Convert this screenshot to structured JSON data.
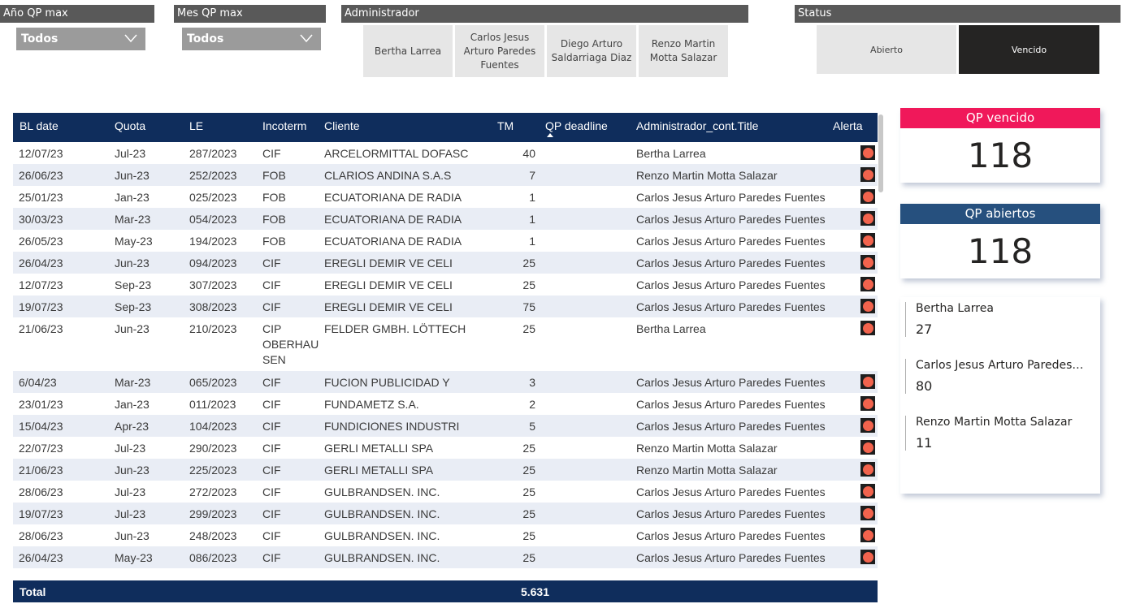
{
  "slicers": {
    "year": {
      "title": "Año QP max",
      "value": "Todos"
    },
    "month": {
      "title": "Mes QP max",
      "value": "Todos"
    },
    "admin": {
      "title": "Administrador",
      "options": [
        "Bertha Larrea",
        "Carlos Jesus Arturo Paredes Fuentes",
        "Diego Arturo Saldarriaga Diaz",
        "Renzo Martin Motta Salazar"
      ]
    },
    "status": {
      "title": "Status",
      "options": [
        "Abierto",
        "Vencido"
      ],
      "selected": "Vencido"
    }
  },
  "table": {
    "headers": [
      "BL date",
      "Quota",
      "LE",
      "Incoterm",
      "Cliente",
      "TM",
      "QP deadline",
      "Administrador_cont.Title",
      "Alerta"
    ],
    "sort_column": "QP deadline",
    "rows": [
      [
        "12/07/23",
        "Jul-23",
        "287/2023",
        "CIF",
        "ARCELORMITTAL DOFASC",
        "40",
        "Bertha Larrea"
      ],
      [
        "26/06/23",
        "Jun-23",
        "252/2023",
        "FOB",
        "CLARIOS ANDINA S.A.S",
        "7",
        "Renzo Martin Motta Salazar"
      ],
      [
        "25/01/23",
        "Jan-23",
        "025/2023",
        "FOB",
        "ECUATORIANA DE RADIA",
        "1",
        "Carlos Jesus Arturo Paredes Fuentes"
      ],
      [
        "30/03/23",
        "Mar-23",
        "054/2023",
        "FOB",
        "ECUATORIANA DE RADIA",
        "1",
        "Carlos Jesus Arturo Paredes Fuentes"
      ],
      [
        "26/05/23",
        "May-23",
        "194/2023",
        "FOB",
        "ECUATORIANA DE RADIA",
        "1",
        "Carlos Jesus Arturo Paredes Fuentes"
      ],
      [
        "26/04/23",
        "Jun-23",
        "094/2023",
        "CIF",
        "EREGLI DEMIR VE CELI",
        "25",
        "Carlos Jesus Arturo Paredes Fuentes"
      ],
      [
        "12/07/23",
        "Sep-23",
        "307/2023",
        "CIF",
        "EREGLI DEMIR VE CELI",
        "25",
        "Carlos Jesus Arturo Paredes Fuentes"
      ],
      [
        "19/07/23",
        "Sep-23",
        "308/2023",
        "CIF",
        "EREGLI DEMIR VE CELI",
        "75",
        "Carlos Jesus Arturo Paredes Fuentes"
      ],
      [
        "21/06/23",
        "Jun-23",
        "210/2023",
        "CIP OBERHAU SEN",
        "FELDER GMBH. LÖTTECH",
        "25",
        "Bertha Larrea"
      ],
      [
        "6/04/23",
        "Mar-23",
        "065/2023",
        "CIF",
        "FUCION PUBLICIDAD Y",
        "3",
        "Carlos Jesus Arturo Paredes Fuentes"
      ],
      [
        "23/01/23",
        "Jan-23",
        "011/2023",
        "CIF",
        "FUNDAMETZ S.A.",
        "2",
        "Carlos Jesus Arturo Paredes Fuentes"
      ],
      [
        "15/04/23",
        "Apr-23",
        "104/2023",
        "CIF",
        "FUNDICIONES INDUSTRI",
        "5",
        "Carlos Jesus Arturo Paredes Fuentes"
      ],
      [
        "22/07/23",
        "Jul-23",
        "290/2023",
        "CIF",
        "GERLI METALLI SPA",
        "25",
        "Renzo Martin Motta Salazar"
      ],
      [
        "21/06/23",
        "Jun-23",
        "225/2023",
        "CIF",
        "GERLI METALLI SPA",
        "25",
        "Renzo Martin Motta Salazar"
      ],
      [
        "28/06/23",
        "Jul-23",
        "272/2023",
        "CIF",
        "GULBRANDSEN. INC.",
        "25",
        "Carlos Jesus Arturo Paredes Fuentes"
      ],
      [
        "19/07/23",
        "Jul-23",
        "299/2023",
        "CIF",
        "GULBRANDSEN. INC.",
        "25",
        "Carlos Jesus Arturo Paredes Fuentes"
      ],
      [
        "28/06/23",
        "Jun-23",
        "248/2023",
        "CIF",
        "GULBRANDSEN. INC.",
        "25",
        "Carlos Jesus Arturo Paredes Fuentes"
      ],
      [
        "26/04/23",
        "May-23",
        "086/2023",
        "CIF",
        "GULBRANDSEN. INC.",
        "25",
        "Carlos Jesus Arturo Paredes Fuentes"
      ]
    ],
    "total_label": "Total",
    "total_tm": "5.631"
  },
  "kpis": {
    "vencido": {
      "title": "QP vencido",
      "value": "118",
      "color": "#f0185a"
    },
    "abiertos": {
      "title": "QP abiertos",
      "value": "118",
      "color": "#26507e"
    }
  },
  "admin_counts": [
    {
      "name": "Bertha Larrea",
      "value": "27"
    },
    {
      "name": "Carlos Jesus Arturo Paredes ...",
      "value": "80"
    },
    {
      "name": "Renzo Martin Motta Salazar",
      "value": "11"
    }
  ],
  "colors": {
    "header_navy": "#0f2d5c",
    "alert_red": "#f2634d",
    "row_alt": "#e9edf5"
  }
}
